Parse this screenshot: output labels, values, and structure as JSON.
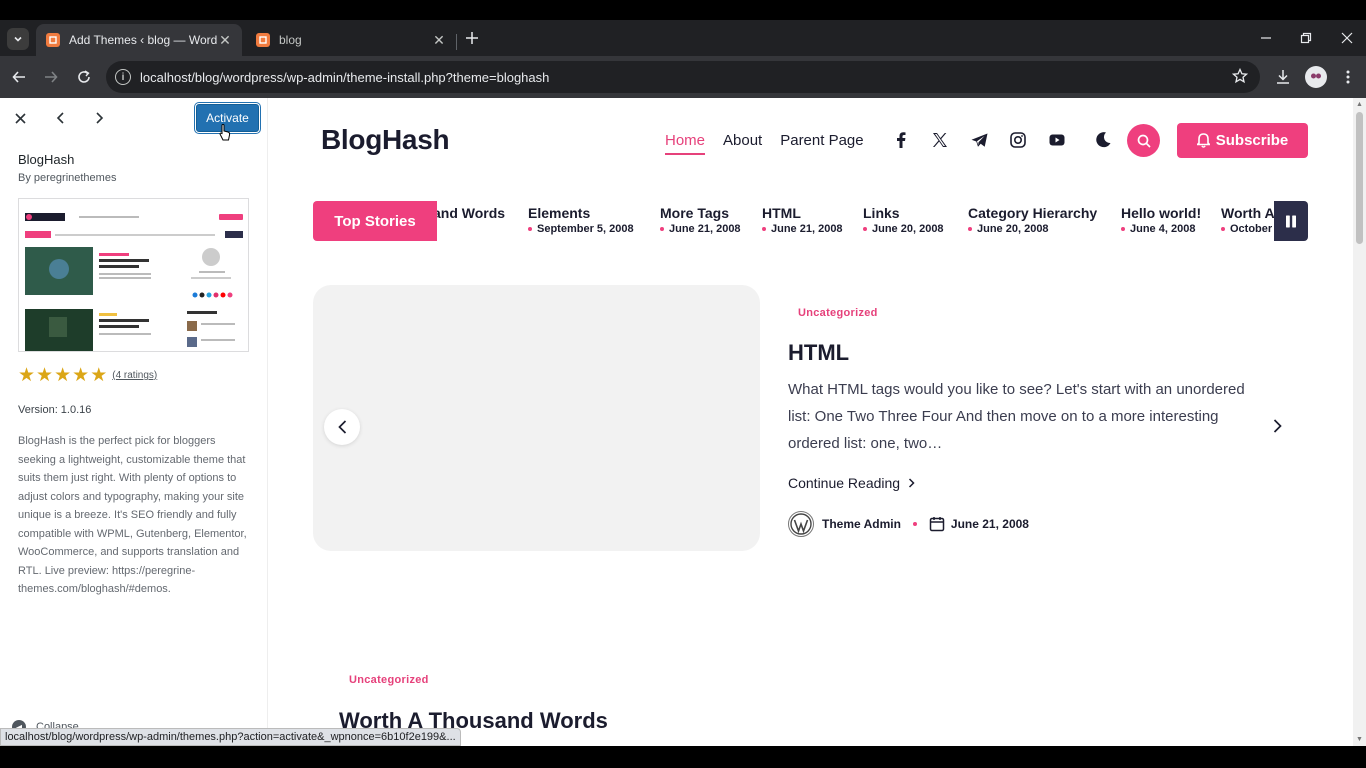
{
  "browser": {
    "tabs": [
      {
        "title": "Add Themes ‹ blog — WordPress",
        "active": true
      },
      {
        "title": "blog",
        "active": false
      }
    ],
    "url": "localhost/blog/wordpress/wp-admin/theme-install.php?theme=bloghash",
    "status_url": "localhost/blog/wordpress/wp-admin/themes.php?action=activate&_wpnonce=6b10f2e199&..."
  },
  "sidebar": {
    "activate_label": "Activate",
    "theme_name": "BlogHash",
    "author": "By peregrinethemes",
    "ratings": "(4 ratings)",
    "stars": 5,
    "version": "Version: 1.0.16",
    "description": "BlogHash is the perfect pick for bloggers seeking a lightweight, customizable theme that suits them just right. With plenty of options to adjust colors and typography, making your site unique is a breeze. It's SEO friendly and fully compatible with WPML, Gutenberg, Elementor, WooCommerce, and supports translation and RTL. Live preview: https://peregrine-themes.com/bloghash/#demos.",
    "collapse_label": "Collapse"
  },
  "preview": {
    "logo": "BlogHash",
    "nav": [
      "Home",
      "About",
      "Parent Page"
    ],
    "subscribe_label": "Subscribe",
    "top_stories_label": "Top Stories",
    "ticker": [
      {
        "title": "and Words",
        "date": ""
      },
      {
        "title": "Elements",
        "date": "September 5, 2008"
      },
      {
        "title": "More Tags",
        "date": "June 21, 2008"
      },
      {
        "title": "HTML",
        "date": "June 21, 2008"
      },
      {
        "title": "Links",
        "date": "June 20, 2008"
      },
      {
        "title": "Category Hierarchy",
        "date": "June 20, 2008"
      },
      {
        "title": "Hello world!",
        "date": "June 4, 2008"
      },
      {
        "title": "Worth A",
        "date": "October"
      }
    ],
    "slide": {
      "category": "Uncategorized",
      "title": "HTML",
      "excerpt": "What HTML tags would you like to see? Let's start with an unordered list: One Two Three Four And then move on to a more interesting ordered list: one, two…",
      "continue_label": "Continue Reading",
      "author": "Theme Admin",
      "date": "June 21, 2008"
    },
    "next_post": {
      "category": "Uncategorized",
      "title": "Worth A Thousand Words"
    }
  },
  "colors": {
    "accent": "#ef3f7e",
    "wp_blue": "#2271b1",
    "dark": "#1b1c2e"
  }
}
